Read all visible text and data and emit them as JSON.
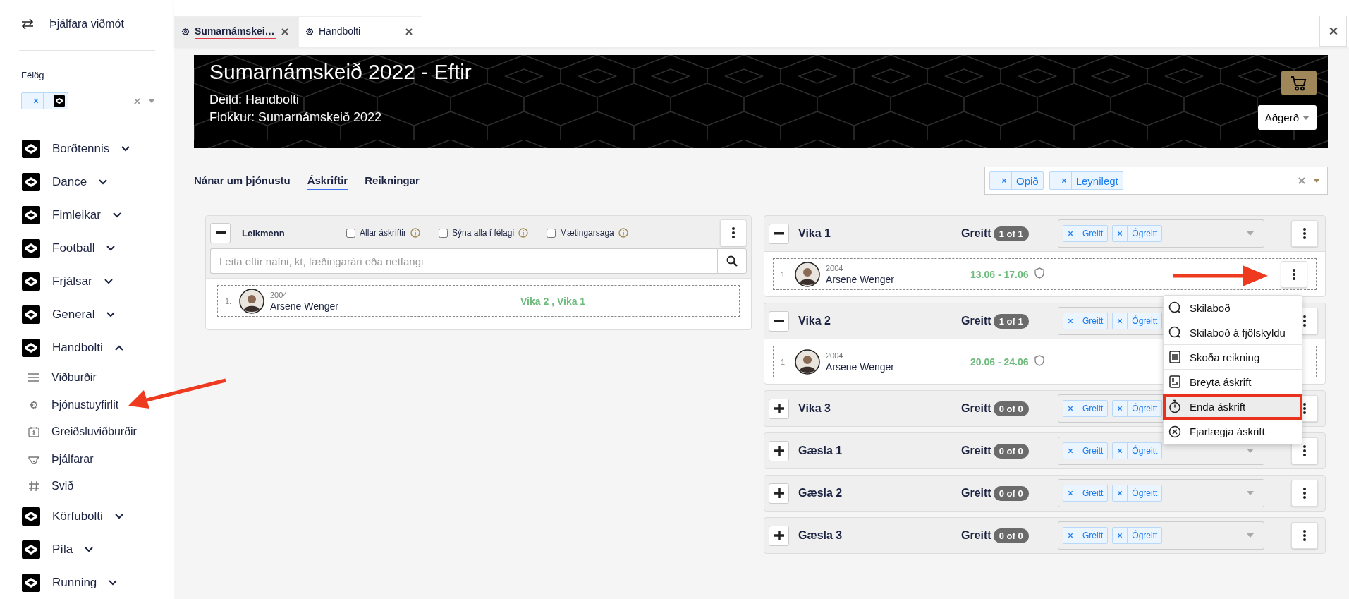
{
  "sidebar": {
    "switch_label": "Þjálfara viðmót",
    "clubs_label": "Félög",
    "club_filter": {
      "tags": [
        {
          "kind": "logo"
        }
      ]
    },
    "items": [
      {
        "label": "Borðtennis",
        "expanded": false
      },
      {
        "label": "Dance",
        "expanded": false
      },
      {
        "label": "Fimleikar",
        "expanded": false
      },
      {
        "label": "Football",
        "expanded": false
      },
      {
        "label": "Frjálsar",
        "expanded": false
      },
      {
        "label": "General",
        "expanded": false
      },
      {
        "label": "Handbolti",
        "expanded": true,
        "children": [
          {
            "label": "Viðburðir"
          },
          {
            "label": "Þjónustuyfirlit"
          },
          {
            "label": "Greiðsluviðburðir"
          },
          {
            "label": "Þjálfarar"
          },
          {
            "label": "Svið"
          }
        ]
      },
      {
        "label": "Körfubolti",
        "expanded": false
      },
      {
        "label": "Píla",
        "expanded": false
      },
      {
        "label": "Running",
        "expanded": false
      }
    ]
  },
  "tabs": [
    {
      "label": "Sumarnámskei…",
      "selected": true
    },
    {
      "label": "Handbolti",
      "selected": false
    }
  ],
  "banner": {
    "title": "Sumarnámskeið 2022 - Eftir",
    "department": "Deild: Handbolti",
    "category": "Flokkur: Sumarnámskeið 2022",
    "action_button": "Aðgerð"
  },
  "page_tabs": [
    {
      "label": "Nánar um þjónustu",
      "selected": false
    },
    {
      "label": "Áskriftir",
      "selected": true
    },
    {
      "label": "Reikningar",
      "selected": false
    }
  ],
  "status_filter": {
    "tags": [
      "Opið",
      "Leynilegt"
    ]
  },
  "players_panel": {
    "title": "Leikmenn",
    "expanded": true,
    "options": [
      {
        "label": "Allar áskriftir",
        "checked": false
      },
      {
        "label": "Sýna alla í félagi",
        "checked": false
      },
      {
        "label": "Mætingarsaga",
        "checked": false
      }
    ],
    "search": {
      "placeholder": "Leita eftir nafni, kt, fæðingarári eða netfangi"
    },
    "rows": [
      {
        "number": "1.",
        "year": "2004",
        "name": "Arsene Wenger",
        "subscriptions": "Vika 2 , Vika 1"
      }
    ]
  },
  "groups": [
    {
      "title": "Vika 1",
      "expanded": true,
      "paid_label": "Greitt",
      "count": "1 of 1",
      "filter_tags": [
        "Greitt",
        "Ógreitt"
      ],
      "rows": [
        {
          "number": "1.",
          "year": "2004",
          "name": "Arsene Wenger",
          "dates": "13.06 - 17.06",
          "actions": true
        }
      ]
    },
    {
      "title": "Vika 2",
      "expanded": true,
      "paid_label": "Greitt",
      "count": "1 of 1",
      "filter_tags": [
        "Greitt",
        "Ógreitt"
      ],
      "caret_visible": false,
      "rows": [
        {
          "number": "1.",
          "year": "2004",
          "name": "Arsene Wenger",
          "dates": "20.06 - 24.06",
          "actions": false
        }
      ]
    },
    {
      "title": "Vika 3",
      "expanded": false,
      "paid_label": "Greitt",
      "count": "0 of 0",
      "filter_tags": [
        "Greitt",
        "Ógreitt"
      ],
      "caret_visible": false
    },
    {
      "title": "Gæsla 1",
      "expanded": false,
      "paid_label": "Greitt",
      "count": "0 of 0",
      "filter_tags": [
        "Greitt",
        "Ógreitt"
      ]
    },
    {
      "title": "Gæsla 2",
      "expanded": false,
      "paid_label": "Greitt",
      "count": "0 of 0",
      "filter_tags": [
        "Greitt",
        "Ógreitt"
      ]
    },
    {
      "title": "Gæsla 3",
      "expanded": false,
      "paid_label": "Greitt",
      "count": "0 of 0",
      "filter_tags": [
        "Greitt",
        "Ógreitt"
      ]
    }
  ],
  "context_menu": {
    "items": [
      {
        "label": "Skilaboð",
        "highlighted": false
      },
      {
        "label": "Skilaboð á fjölskyldu",
        "highlighted": false
      },
      {
        "label": "Skoða reikning",
        "highlighted": false
      },
      {
        "label": "Breyta áskrift",
        "highlighted": false
      },
      {
        "label": "Enda áskrift",
        "highlighted": true
      },
      {
        "label": "Fjarlægja áskrift",
        "highlighted": false
      }
    ]
  }
}
